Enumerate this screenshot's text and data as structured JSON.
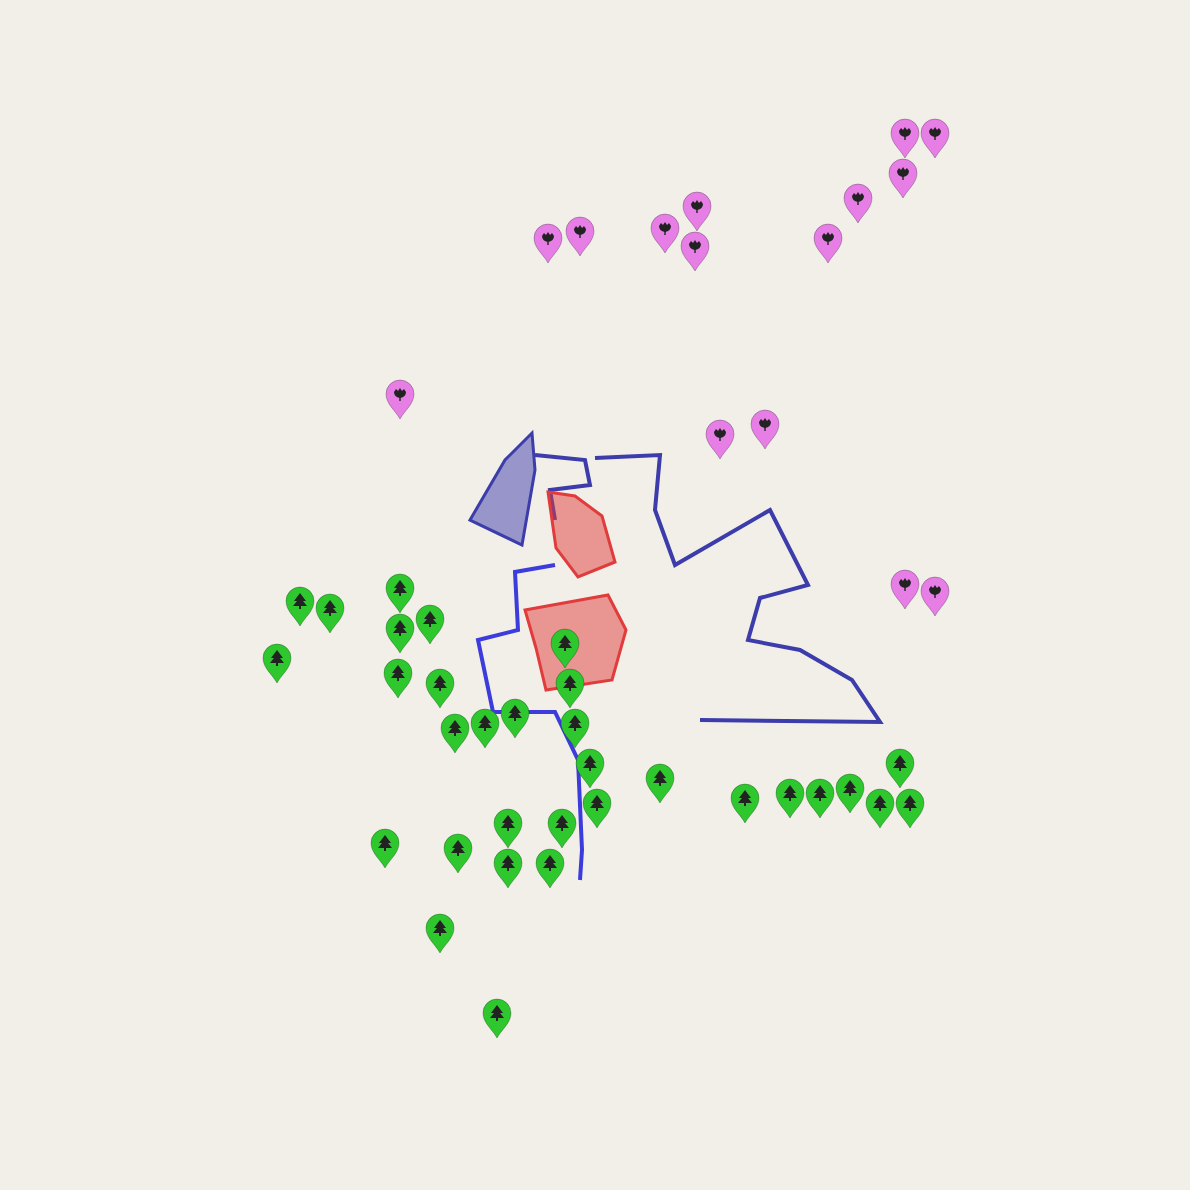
{
  "map": {
    "areas": [
      {
        "color": "#3c3caa"
      },
      {
        "color": "#3c3caa"
      },
      {
        "color": "#3c3caa"
      },
      {
        "color": "#e03c3c"
      },
      {
        "color": "#e03c3c"
      },
      {
        "color": "#3c3cdc"
      }
    ],
    "markers": [
      {
        "kind": "flower",
        "color": "#e67ee6"
      },
      {
        "kind": "flower",
        "color": "#e67ee6"
      },
      {
        "kind": "flower",
        "color": "#e67ee6"
      },
      {
        "kind": "flower",
        "color": "#e67ee6"
      },
      {
        "kind": "flower",
        "color": "#e67ee6"
      },
      {
        "kind": "flower",
        "color": "#e67ee6"
      },
      {
        "kind": "flower",
        "color": "#e67ee6"
      },
      {
        "kind": "flower",
        "color": "#e67ee6"
      },
      {
        "kind": "flower",
        "color": "#e67ee6"
      },
      {
        "kind": "flower",
        "color": "#e67ee6"
      },
      {
        "kind": "flower",
        "color": "#e67ee6"
      },
      {
        "kind": "flower",
        "color": "#e67ee6"
      },
      {
        "kind": "flower",
        "color": "#e67ee6"
      },
      {
        "kind": "flower",
        "color": "#e67ee6"
      },
      {
        "kind": "flower",
        "color": "#e67ee6"
      },
      {
        "kind": "tree",
        "color": "#2ec82e"
      },
      {
        "kind": "tree",
        "color": "#2ec82e"
      },
      {
        "kind": "tree",
        "color": "#2ec82e"
      },
      {
        "kind": "tree",
        "color": "#2ec82e"
      },
      {
        "kind": "tree",
        "color": "#2ec82e"
      },
      {
        "kind": "tree",
        "color": "#2ec82e"
      },
      {
        "kind": "tree",
        "color": "#2ec82e"
      },
      {
        "kind": "tree",
        "color": "#2ec82e"
      },
      {
        "kind": "tree",
        "color": "#2ec82e"
      },
      {
        "kind": "tree",
        "color": "#2ec82e"
      },
      {
        "kind": "tree",
        "color": "#2ec82e"
      },
      {
        "kind": "tree",
        "color": "#2ec82e"
      },
      {
        "kind": "tree",
        "color": "#2ec82e"
      },
      {
        "kind": "tree",
        "color": "#2ec82e"
      },
      {
        "kind": "tree",
        "color": "#2ec82e"
      },
      {
        "kind": "tree",
        "color": "#2ec82e"
      },
      {
        "kind": "tree",
        "color": "#2ec82e"
      },
      {
        "kind": "tree",
        "color": "#2ec82e"
      },
      {
        "kind": "tree",
        "color": "#2ec82e"
      },
      {
        "kind": "tree",
        "color": "#2ec82e"
      },
      {
        "kind": "tree",
        "color": "#2ec82e"
      },
      {
        "kind": "tree",
        "color": "#2ec82e"
      },
      {
        "kind": "tree",
        "color": "#2ec82e"
      },
      {
        "kind": "tree",
        "color": "#2ec82e"
      },
      {
        "kind": "tree",
        "color": "#2ec82e"
      },
      {
        "kind": "tree",
        "color": "#2ec82e"
      },
      {
        "kind": "tree",
        "color": "#2ec82e"
      },
      {
        "kind": "tree",
        "color": "#2ec82e"
      },
      {
        "kind": "tree",
        "color": "#2ec82e"
      },
      {
        "kind": "tree",
        "color": "#2ec82e"
      },
      {
        "kind": "tree",
        "color": "#2ec82e"
      },
      {
        "kind": "tree",
        "color": "#2ec82e"
      }
    ]
  }
}
